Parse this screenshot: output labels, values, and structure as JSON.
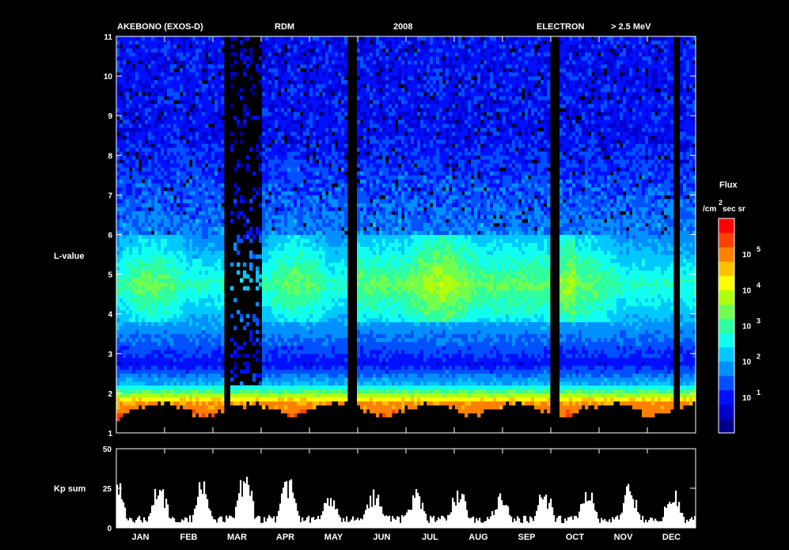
{
  "header": {
    "mission": "AKEBONO (EXOS-D)",
    "instrument": "RDM",
    "year": "2008",
    "species": "ELECTRON",
    "energy": "> 2.5 MeV"
  },
  "chart_data": [
    {
      "type": "heatmap",
      "title": "",
      "xlabel": "",
      "ylabel": "L-value",
      "x_categories": [
        "JAN",
        "FEB",
        "MAR",
        "APR",
        "MAY",
        "JUN",
        "JUL",
        "AUG",
        "SEP",
        "OCT",
        "NOV",
        "DEC"
      ],
      "ylim": [
        1,
        11
      ],
      "yticks": [
        "1",
        "2",
        "3",
        "4",
        "5",
        "6",
        "7",
        "8",
        "9",
        "10",
        "11"
      ],
      "colorbar": {
        "title": "Flux",
        "unit_parts": [
          "/cm",
          "2",
          "sec sr"
        ],
        "scale": "log",
        "range_exponent": [
          0,
          6
        ],
        "ticks": [
          {
            "base": "10",
            "exp": "1",
            "value": 1
          },
          {
            "base": "10",
            "exp": "2",
            "value": 2
          },
          {
            "base": "10",
            "exp": "3",
            "value": 3
          },
          {
            "base": "10",
            "exp": "4",
            "value": 4
          },
          {
            "base": "10",
            "exp": "5",
            "value": 5
          }
        ],
        "colors": [
          "#00008f",
          "#0000cf",
          "#0010ff",
          "#0050ff",
          "#0090ff",
          "#00c8ff",
          "#10ffef",
          "#30ff9f",
          "#70ff50",
          "#b0ff10",
          "#ffff00",
          "#ffc000",
          "#ff8000",
          "#ff4000",
          "#ff0000"
        ]
      },
      "approx_profile": [
        {
          "L": 1.25,
          "log_flux_typ": 5.5
        },
        {
          "L": 1.75,
          "log_flux_typ": 5.0
        },
        {
          "L": 2.0,
          "log_flux_typ": 3.5
        },
        {
          "L": 2.25,
          "log_flux_typ": 2.0
        },
        {
          "L": 2.75,
          "log_flux_typ": 0.8
        },
        {
          "L": 3.5,
          "log_flux_typ": 1.6
        },
        {
          "L": 4.75,
          "log_flux_typ": 2.8
        },
        {
          "L": 6.0,
          "log_flux_typ": 1.6
        },
        {
          "L": 8.5,
          "log_flux_typ": 0.8
        }
      ],
      "data_gap_months": [
        2.3,
        4.9,
        9.1,
        11.6
      ]
    },
    {
      "type": "bar",
      "title": "",
      "xlabel": "",
      "ylabel": "Kp sum",
      "x_categories": [
        "JAN",
        "FEB",
        "MAR",
        "APR",
        "MAY",
        "JUN",
        "JUL",
        "AUG",
        "SEP",
        "OCT",
        "NOV",
        "DEC"
      ],
      "ylim": [
        0,
        50
      ],
      "yticks": [
        "0",
        "25",
        "50"
      ],
      "approx_monthly_peak": [
        22,
        22,
        30,
        27,
        15,
        18,
        19,
        20,
        17,
        21,
        20,
        18
      ]
    }
  ]
}
